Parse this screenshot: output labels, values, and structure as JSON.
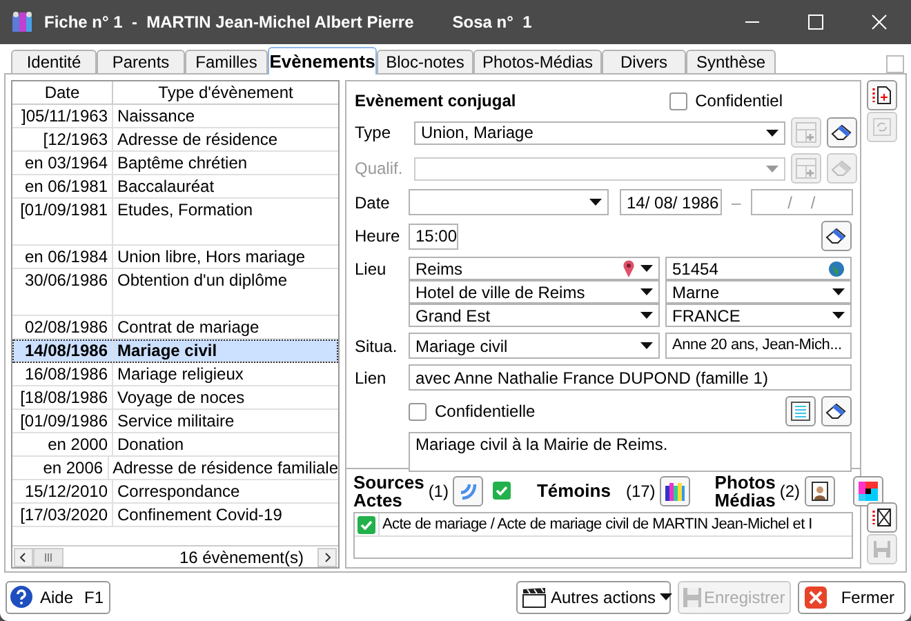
{
  "window": {
    "title": "Fiche n° 1  -  MARTIN Jean-Michel Albert Pierre",
    "sosa": "Sosa n°  1"
  },
  "tabs": [
    {
      "label": "Identité",
      "selected": false
    },
    {
      "label": "Parents",
      "selected": false
    },
    {
      "label": "Familles",
      "selected": false
    },
    {
      "label": "Evènements",
      "selected": true
    },
    {
      "label": "Bloc-notes",
      "selected": false
    },
    {
      "label": "Photos-Médias",
      "selected": false
    },
    {
      "label": "Divers",
      "selected": false
    },
    {
      "label": "Synthèse",
      "selected": false
    }
  ],
  "events": {
    "columns": [
      "Date",
      "Type d'évènement"
    ],
    "rows": [
      {
        "date": "]05/11/1963",
        "type": "Naissance",
        "selected": false,
        "tall": false
      },
      {
        "date": "[12/1963",
        "type": "Adresse de résidence",
        "selected": false,
        "tall": false
      },
      {
        "date": "en 03/1964",
        "type": "Baptême chrétien",
        "selected": false,
        "tall": false
      },
      {
        "date": "en 06/1981",
        "type": "Baccalauréat",
        "selected": false,
        "tall": false
      },
      {
        "date": "[01/09/1981",
        "type": "Etudes, Formation",
        "selected": false,
        "tall": true
      },
      {
        "date": "en 06/1984",
        "type": "Union libre, Hors mariage",
        "selected": false,
        "tall": false
      },
      {
        "date": "30/06/1986",
        "type": "Obtention d'un diplôme",
        "selected": false,
        "tall": true
      },
      {
        "date": "02/08/1986",
        "type": "Contrat de mariage",
        "selected": false,
        "tall": false
      },
      {
        "date": "14/08/1986",
        "type": "Mariage civil",
        "selected": true,
        "tall": false
      },
      {
        "date": "16/08/1986",
        "type": "Mariage religieux",
        "selected": false,
        "tall": false
      },
      {
        "date": "[18/08/1986",
        "type": "Voyage de noces",
        "selected": false,
        "tall": false
      },
      {
        "date": "[01/09/1986",
        "type": "Service militaire",
        "selected": false,
        "tall": false
      },
      {
        "date": "en 2000",
        "type": "Donation",
        "selected": false,
        "tall": false
      },
      {
        "date": "en 2006",
        "type": "Adresse de résidence familiale",
        "selected": false,
        "tall": false
      },
      {
        "date": "15/12/2010",
        "type": "Correspondance",
        "selected": false,
        "tall": false
      },
      {
        "date": "[17/03/2020",
        "type": "Confinement Covid-19",
        "selected": false,
        "tall": false
      }
    ],
    "count": "16 évènement(s)"
  },
  "detail": {
    "heading": "Evènement conjugal",
    "confidential": {
      "label": "Confidentiel",
      "checked": false
    },
    "type": {
      "label": "Type",
      "value": "Union, Mariage"
    },
    "qualif": {
      "label": "Qualif.",
      "disabled": true
    },
    "date": {
      "label": "Date",
      "date": "14/ 08/ 1986",
      "dash": "–",
      "date2": "/    /"
    },
    "time": {
      "label": "Heure",
      "value": "15:00"
    },
    "place": {
      "label": "Lieu",
      "city": "Reims",
      "code": "51454",
      "site": "Hotel de ville de Reims",
      "department": "Marne",
      "region": "Grand Est",
      "country": "FRANCE"
    },
    "situation": {
      "label": "Situa.",
      "value": "Mariage civil",
      "ages": "Anne 20 ans, Jean-Mich..."
    },
    "link": {
      "label": "Lien",
      "value": "avec Anne Nathalie France DUPOND (famille 1)"
    },
    "note_confidential": {
      "label": "Confidentielle",
      "checked": false
    },
    "note": "Mariage civil à la Mairie de Reims.",
    "sources": {
      "label": [
        "Sources",
        "Actes"
      ],
      "count": "(1)",
      "checked": true
    },
    "witnesses": {
      "label": "Témoins",
      "count": "(17)"
    },
    "media": {
      "label": [
        "Photos",
        "Médias"
      ],
      "count": "(2)"
    },
    "source_items": [
      {
        "text": "Acte de mariage / Acte de mariage civil de MARTIN Jean-Michel et I",
        "checked": true
      }
    ]
  },
  "footer": {
    "help": "Aide",
    "help_key": "F1",
    "more": "Autres actions",
    "save": {
      "label": "Enregistrer",
      "disabled": true
    },
    "close": "Fermer"
  }
}
